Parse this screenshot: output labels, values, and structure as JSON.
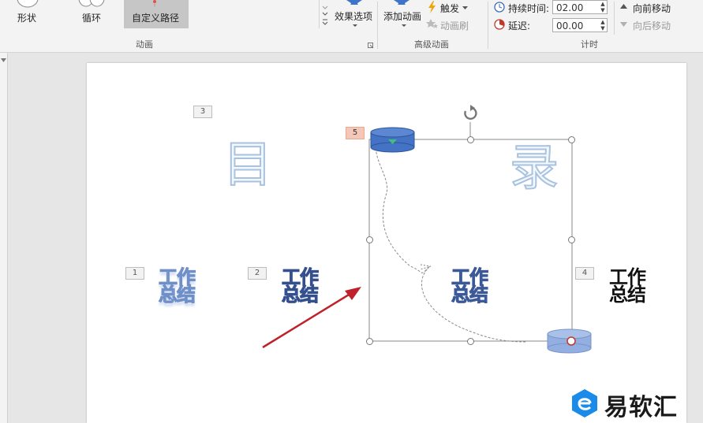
{
  "ribbon": {
    "animation_items": [
      {
        "label": "形状",
        "icon": "shape-circle-icon"
      },
      {
        "label": "循环",
        "icon": "loop-icon"
      },
      {
        "label": "自定义路径",
        "icon": "custom-path-icon",
        "selected": true
      }
    ],
    "effect_options": "效果选项",
    "group_animation": "动画",
    "add_animation": "添加动画",
    "trigger": "触发",
    "animation_painter": "动画刷",
    "group_advanced": "高级动画",
    "duration_label": "持续时间:",
    "duration_value": "02.00",
    "delay_label": "延迟:",
    "delay_value": "00.00",
    "move_earlier": "向前移动",
    "move_later": "向后移动",
    "group_timing": "计时",
    "colors": {
      "accent_selected": "#c6c6c6",
      "trigger_icon": "#f0a30a"
    }
  },
  "slide": {
    "title_left": "目",
    "title_right": "录",
    "wordart_line1": "工作",
    "wordart_line2": "总结",
    "badges": [
      "1",
      "2",
      "3",
      "4",
      "5"
    ],
    "colors": {
      "path_object": "#4472c4",
      "arrow": "#c0202a"
    }
  },
  "watermark": {
    "text": "易软汇",
    "color": "#1a8be8"
  }
}
